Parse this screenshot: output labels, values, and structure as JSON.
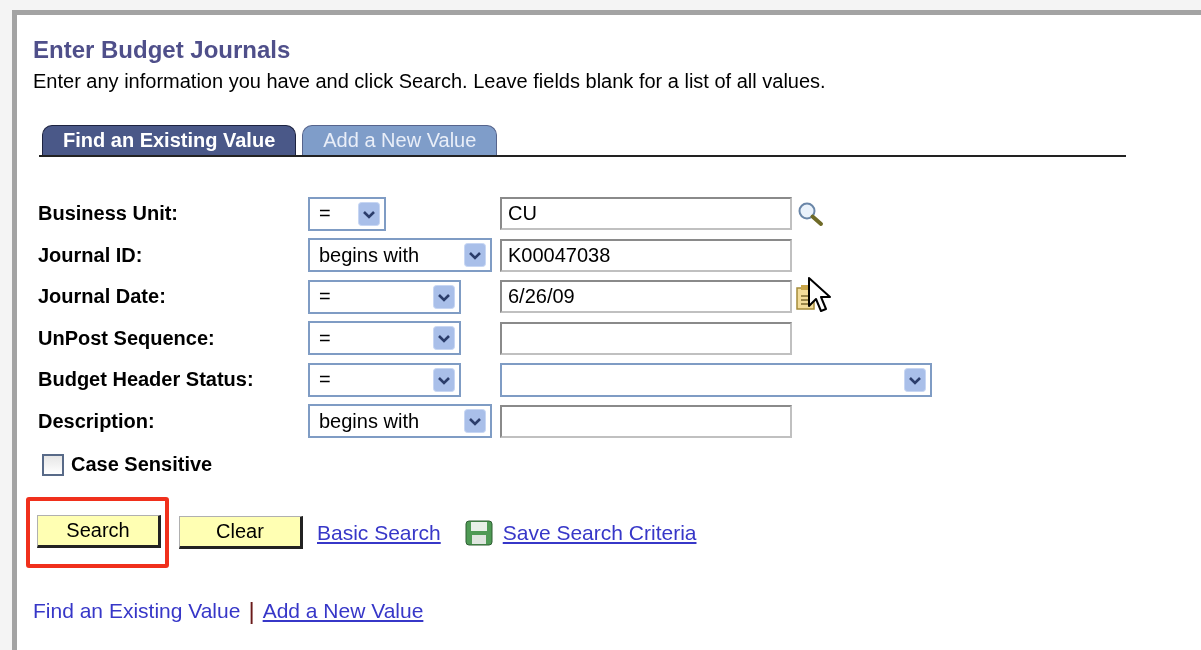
{
  "title": "Enter Budget Journals",
  "instructions": "Enter any information you have and click Search. Leave fields blank for a list of all values.",
  "tabs": [
    {
      "label": "Find an Existing Value",
      "selected": true
    },
    {
      "label": "Add a New Value",
      "selected": false
    }
  ],
  "fields": [
    {
      "label": "Business Unit:",
      "operator": "=",
      "kind": "text",
      "value": "CU"
    },
    {
      "label": "Journal ID:",
      "operator": "begins with",
      "kind": "text",
      "value": "K00047038"
    },
    {
      "label": "Journal Date:",
      "operator": "=",
      "kind": "text",
      "value": "6/26/09"
    },
    {
      "label": "UnPost Sequence:",
      "operator": "=",
      "kind": "text"
    },
    {
      "label": "Budget Header Status:",
      "operator": "=",
      "kind": "select"
    },
    {
      "label": "Description:",
      "operator": "begins with",
      "kind": "text"
    }
  ],
  "case_sensitive": {
    "label": "Case Sensitive",
    "checked": false
  },
  "buttons": [
    {
      "label": "Search",
      "highlighted": true
    },
    {
      "label": "Clear",
      "highlighted": false
    }
  ],
  "links": [
    {
      "label": "Basic Search"
    },
    {
      "label": "Save Search Criteria"
    }
  ],
  "footer_links": [
    {
      "label": "Find an Existing Value",
      "current": true
    },
    {
      "label": "Add a New Value",
      "current": false
    }
  ],
  "footer_separator": "|"
}
